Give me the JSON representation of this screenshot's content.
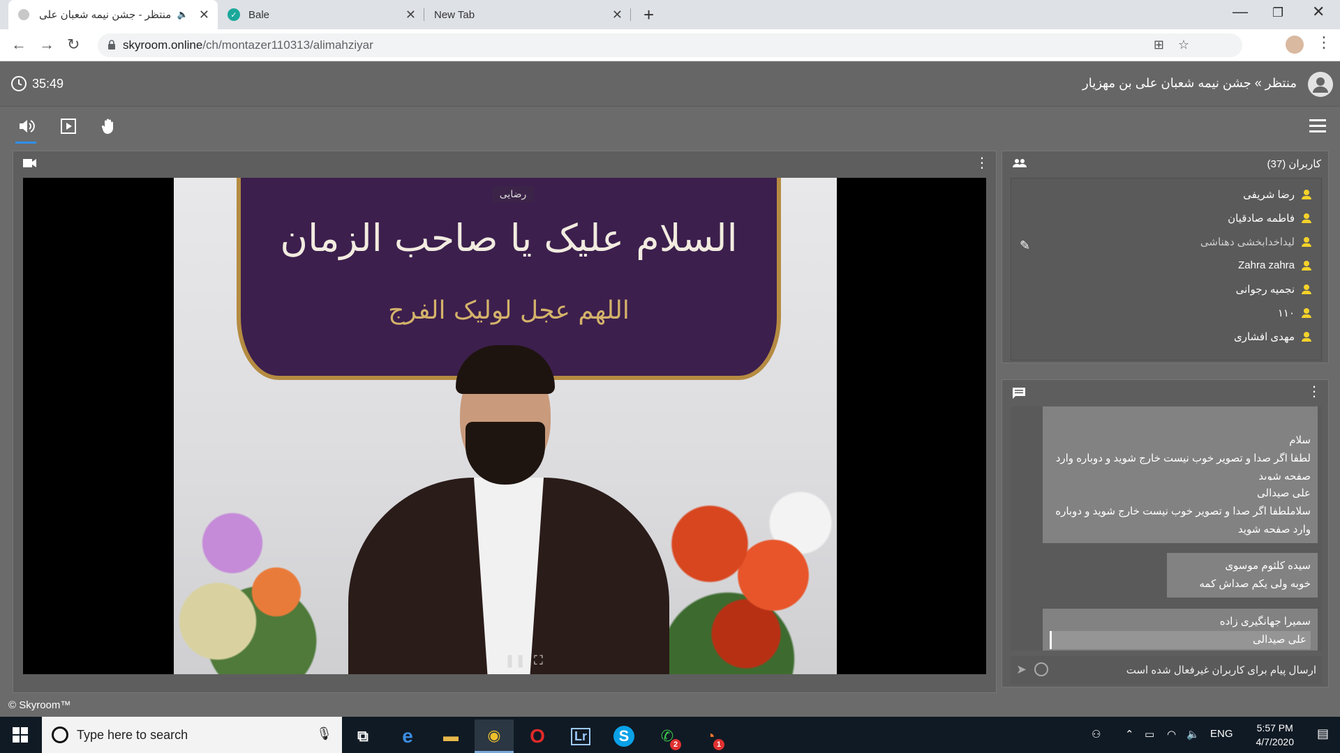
{
  "browser": {
    "tabs": [
      {
        "title": "منتظر - جشن نیمه شعبان علی"
      },
      {
        "title": "Bale"
      },
      {
        "title": "New Tab"
      }
    ],
    "url_host": "skyroom.online",
    "url_path": "/ch/montazer110313/alimahziyar"
  },
  "app": {
    "timer": "35:49",
    "room_title": "منتظر » جشن نیمه شعبان علی بن مهزیار",
    "video": {
      "speaker_label": "رضایی",
      "banner_line1": "السلام علیک یا صاحب الزمان",
      "banner_line2": "اللهم عجل لولیک الفرج"
    },
    "users": {
      "title": "کاربران (37)",
      "list": [
        {
          "name": "رضا شریفی",
          "dim": false
        },
        {
          "name": "فاطمه صادقیان",
          "dim": false
        },
        {
          "name": "لیداخدابخشی دهناشی",
          "dim": true
        },
        {
          "name": "Zahra zahra",
          "dim": false
        },
        {
          "name": "نجمیه رجوانی",
          "dim": false
        },
        {
          "name": "۱۱۰",
          "dim": false
        },
        {
          "name": "مهدی افشاری",
          "dim": false
        }
      ]
    },
    "chat": {
      "messages": [
        {
          "sender": "",
          "text": "سلام\nلطفا اگر صدا و تصویر خوب نیست خارج شوید و دوباره وارد صفحه شوید"
        },
        {
          "sender": "علی صیدالی",
          "text": "سلاملطفا اگر صدا و تصویر خوب نیست خارج شوید و دوباره وارد صفحه شوید"
        },
        {
          "sender": "سیده کلثوم موسوی",
          "text": "خوبه ولی یکم صداش کمه"
        },
        {
          "sender": "سمیرا جهانگیری زاده",
          "text": "علی صیدالی"
        }
      ],
      "input_placeholder": "ارسال پیام برای کاربران غیرفعال شده است"
    },
    "copyright": "© Skyroom™"
  },
  "taskbar": {
    "search_placeholder": "Type here to search",
    "apps": [
      {
        "name": "task-view",
        "label": "⧉"
      },
      {
        "name": "edge",
        "label": "e"
      },
      {
        "name": "file-explorer",
        "label": "▬"
      },
      {
        "name": "chrome",
        "label": "◉"
      },
      {
        "name": "opera",
        "label": "O"
      },
      {
        "name": "lightroom",
        "label": "Lr"
      },
      {
        "name": "skype",
        "label": "S"
      },
      {
        "name": "whatsapp",
        "label": "✆",
        "badge": "2"
      },
      {
        "name": "app-orange",
        "label": "◔",
        "badge": "1"
      }
    ],
    "language": "ENG",
    "time": "5:57 PM",
    "date": "4/7/2020"
  },
  "colors": {
    "app_bg": "#6b6b6b",
    "panel_bg": "#5e5e5e",
    "user_icon": "#f4d22a",
    "accent_blue": "#2f8ff0",
    "taskbar_bg": "#101a24"
  }
}
